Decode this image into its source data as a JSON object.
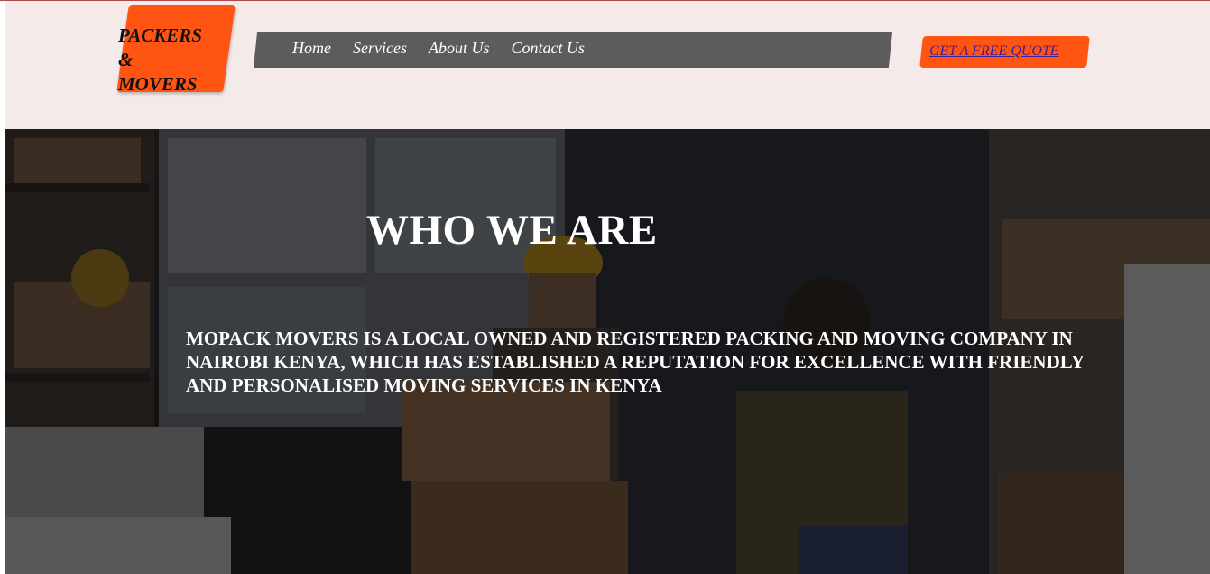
{
  "logo": {
    "line1": "PACKERS",
    "line2": "&",
    "line3": "MOVERS"
  },
  "nav": {
    "items": [
      "Home",
      "Services",
      "About Us",
      "Contact Us"
    ]
  },
  "cta": {
    "label": "GET A FREE QUOTE"
  },
  "hero": {
    "title": "WHO WE ARE",
    "description": "MOPACK MOVERS IS A LOCAL OWNED AND REGISTERED PACKING AND MOVING COMPANY IN NAIROBI KENYA, WHICH HAS ESTABLISHED A REPUTATION FOR EXCELLENCE WITH FRIENDLY AND PERSONALISED MOVING SERVICES IN KENYA"
  },
  "colors": {
    "header_bg": "#f4eaea",
    "accent_orange": "#ff5412",
    "nav_bg": "#5c5b5d",
    "cta_link": "#3a1f9e"
  }
}
